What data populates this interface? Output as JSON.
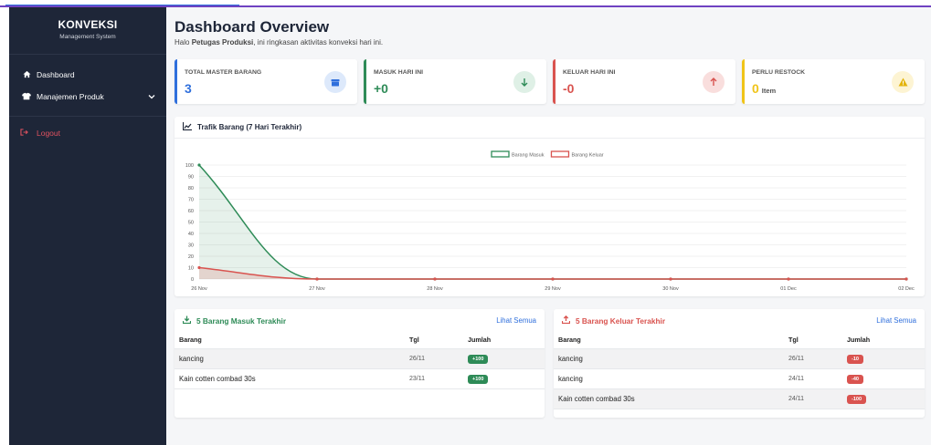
{
  "colors": {
    "sidebar_bg": "#1e2638",
    "blue": "#2f6fdc",
    "green": "#2e8b57",
    "red": "#d9534f",
    "yellow": "#f0c419"
  },
  "sidebar": {
    "brand_title": "KONVEKSI",
    "brand_subtitle": "Management System",
    "items": [
      {
        "label": "Dashboard",
        "icon": "home-icon"
      },
      {
        "label": "Manajemen Produk",
        "icon": "shirt-icon",
        "has_submenu": true
      }
    ],
    "logout_label": "Logout",
    "logout_icon": "logout-icon"
  },
  "header": {
    "title": "Dashboard Overview",
    "greeting_prefix": "Halo",
    "greeting_name": "Petugas Produksi",
    "greeting_suffix": ", ini ringkasan aktivitas konveksi hari ini."
  },
  "stats": [
    {
      "label": "TOTAL MASTER BARANG",
      "value": "3",
      "unit": "",
      "icon": "box-icon",
      "color": "#2f6fdc"
    },
    {
      "label": "MASUK HARI INI",
      "value": "+0",
      "unit": "",
      "icon": "arrow-down-icon",
      "color": "#2e8b57"
    },
    {
      "label": "KELUAR HARI INI",
      "value": "-0",
      "unit": "",
      "icon": "arrow-up-icon",
      "color": "#d9534f"
    },
    {
      "label": "PERLU RESTOCK",
      "value": "0",
      "unit": "Item",
      "icon": "warning-icon",
      "color": "#f0c419"
    }
  ],
  "chart_panel": {
    "title": "Trafik Barang (7 Hari Terakhir)",
    "icon": "chart-line-icon"
  },
  "chart_data": {
    "type": "line",
    "x": [
      "26 Nov",
      "27 Nov",
      "28 Nov",
      "29 Nov",
      "30 Nov",
      "01 Dec",
      "02 Dec"
    ],
    "series": [
      {
        "name": "Barang Masuk",
        "values": [
          100,
          0,
          0,
          0,
          0,
          0,
          0
        ],
        "color": "#2e8b57"
      },
      {
        "name": "Barang Keluar",
        "values": [
          10,
          0,
          0,
          0,
          0,
          0,
          0
        ],
        "color": "#d9534f"
      }
    ],
    "yticks": [
      "0",
      "10",
      "20",
      "30",
      "40",
      "50",
      "60",
      "70",
      "80",
      "90",
      "100"
    ],
    "ylim": [
      0,
      100
    ],
    "grid": true,
    "legend_position": "top-center",
    "fill": true
  },
  "masuk_table": {
    "title": "5 Barang Masuk Terakhir",
    "icon": "download-icon",
    "link": "Lihat Semua",
    "columns": [
      "Barang",
      "Tgl",
      "Jumlah"
    ],
    "rows": [
      {
        "barang": "kancing",
        "tgl": "26/11",
        "jumlah": "+100"
      },
      {
        "barang": "Kain cotten combad 30s",
        "tgl": "23/11",
        "jumlah": "+100"
      }
    ]
  },
  "keluar_table": {
    "title": "5 Barang Keluar Terakhir",
    "icon": "upload-icon",
    "link": "Lihat Semua",
    "columns": [
      "Barang",
      "Tgl",
      "Jumlah"
    ],
    "rows": [
      {
        "barang": "kancing",
        "tgl": "26/11",
        "jumlah": "-10"
      },
      {
        "barang": "kancing",
        "tgl": "24/11",
        "jumlah": "-40"
      },
      {
        "barang": "Kain cotten combad 30s",
        "tgl": "24/11",
        "jumlah": "-100"
      }
    ]
  }
}
